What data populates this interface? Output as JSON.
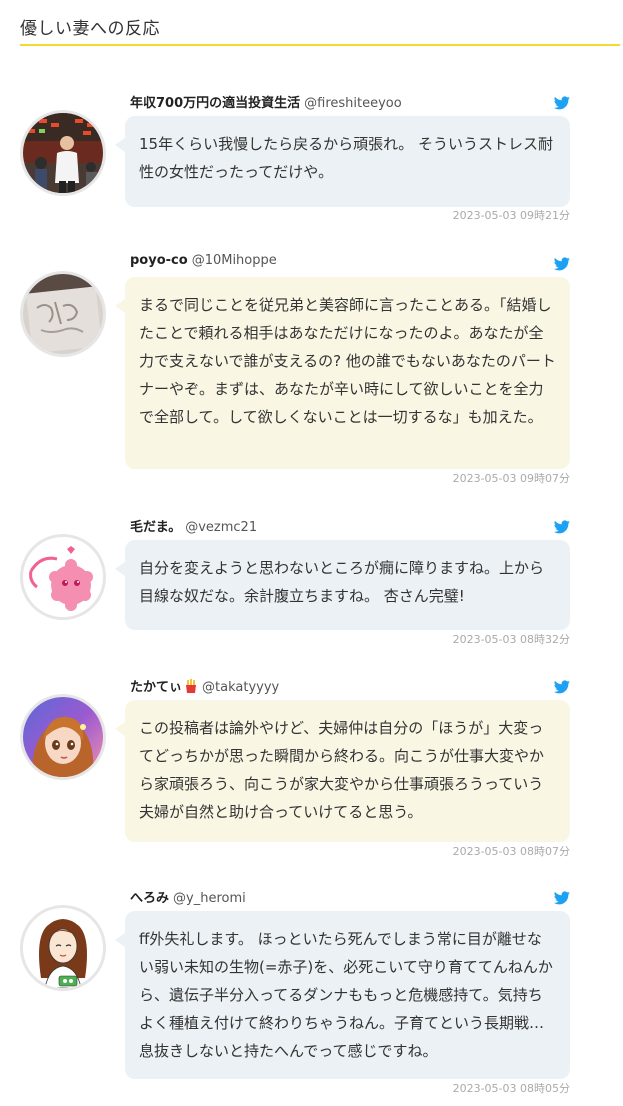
{
  "header": {
    "title": "優しい妻への反応"
  },
  "colors": {
    "accent_underline": "#f2db2e",
    "bubble_blue": "#ebf1f4",
    "bubble_cream": "#faf6e4",
    "twitter_blue": "#1da1f2"
  },
  "tweets": [
    {
      "user_name": "年収700万円の適当投資生活",
      "user_id": "@fireshiteeyoo",
      "text": "15年くらい我慢したら戻るから頑張れ。 そういうストレス耐性の女性だったってだけや。",
      "timestamp": "2023-05-03 09時21分",
      "avatar_icon": "photo-avatar-man",
      "bubble_style": "blue"
    },
    {
      "user_name": "poyo-co",
      "user_id": "@10Mihoppe",
      "text": "まるで同じことを従兄弟と美容師に言ったことある。「結婚したことで頼れる相手はあなただけになったのよ。あなたが全力で支えないで誰が支えるの? 他の誰でもないあなたのパートナーやぞ。まずは、あなたが辛い時にして欲しいことを全力で全部して。して欲しくないことは一切するな」も加えた。",
      "timestamp": "2023-05-03 09時07分",
      "avatar_icon": "sketch-avatar",
      "bubble_style": "cream"
    },
    {
      "user_name": "毛だま。",
      "user_id": "@vezmc21",
      "text": "自分を変えようと思わないところが癇に障りますね。上から目線な奴だな。余計腹立ちますね。 杏さん完璧!",
      "timestamp": "2023-05-03 08時32分",
      "avatar_icon": "pink-fluff-avatar",
      "bubble_style": "blue"
    },
    {
      "user_name": "たかてぃ",
      "user_id": "@takatyyyy",
      "text": "この投稿者は論外やけど、夫婦仲は自分の「ほうが」大変ってどっちかが思った瞬間から終わる。向こうが仕事大変やから家頑張ろう、向こうが家大変やから仕事頑張ろうっていう夫婦が自然と助け合っていけてると思う。",
      "timestamp": "2023-05-03 08時07分",
      "avatar_icon": "anime-girl-avatar",
      "badge_icon": "fries-emoji-icon",
      "bubble_style": "cream"
    },
    {
      "user_name": "へろみ",
      "user_id": "@y_heromi",
      "text": "ff外失礼します。 ほっといたら死んでしまう常に目が離せない弱い未知の生物(=赤子)を、必死こいて守り育ててんねんから、遺伝子半分入ってるダンナももっと危機感持て。気持ちよく種植え付けて終わりちゃうねん。子育てという長期戦…息抜きしないと持たへんでって感じですね。",
      "timestamp": "2023-05-03 08時05分",
      "avatar_icon": "illustrated-woman-avatar",
      "bubble_style": "blue"
    }
  ]
}
